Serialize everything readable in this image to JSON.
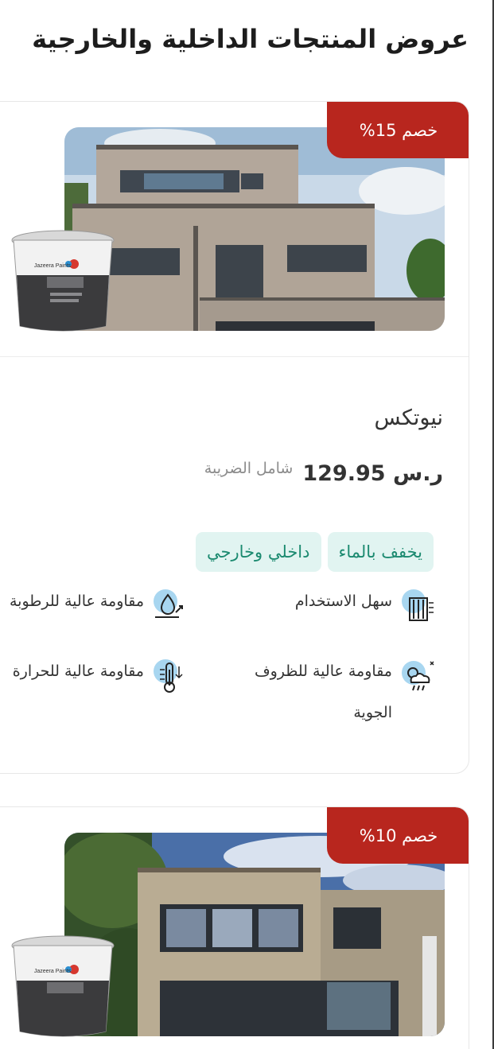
{
  "page": {
    "title": "عروض المنتجات الداخلية والخارجية"
  },
  "products": [
    {
      "discount": "خصم 15%",
      "name": "نيوتكس",
      "price": "129.95 ر.س",
      "price_note": "شامل الضريبة",
      "tags": [
        "يخفف بالماء",
        "داخلي وخارجي"
      ],
      "features": [
        {
          "label": "سهل الاستخدام",
          "icon": "roller-brush-icon"
        },
        {
          "label": "مقاومة عالية للرطوبة",
          "icon": "water-drop-icon"
        },
        {
          "label": "مقاومة عالية للظروف الجوية",
          "icon": "weather-icon"
        },
        {
          "label": "مقاومة عالية للحرارة",
          "icon": "thermometer-icon"
        }
      ],
      "bucket_label": "Jazeera Paints"
    },
    {
      "discount": "خصم 10%",
      "bucket_label": "Jazeera Paints"
    }
  ],
  "colors": {
    "badge": "#b8261e",
    "tag_bg": "#e1f4f1",
    "tag_text": "#1b8a70",
    "icon_bg": "#a8d6f0"
  }
}
